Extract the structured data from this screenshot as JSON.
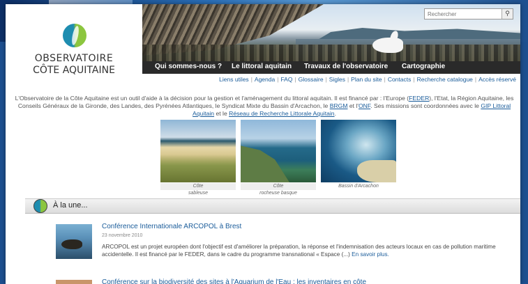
{
  "site": {
    "logo_line1": "OBSERVATOIRE",
    "logo_line2": "CÔTE AQUITAINE"
  },
  "search": {
    "placeholder": "Rechercher",
    "button_icon": "search-icon"
  },
  "main_nav": [
    {
      "label": "Qui sommes-nous ?"
    },
    {
      "label": "Le littoral aquitain"
    },
    {
      "label": "Travaux de l'observatoire"
    },
    {
      "label": "Cartographie"
    }
  ],
  "sub_nav": [
    {
      "label": "Liens utiles"
    },
    {
      "label": "Agenda"
    },
    {
      "label": "FAQ"
    },
    {
      "label": "Glossaire"
    },
    {
      "label": "Sigles"
    },
    {
      "label": "Plan du site"
    },
    {
      "label": "Contacts"
    },
    {
      "label": "Recherche catalogue"
    },
    {
      "label": "Accès réservé"
    }
  ],
  "intro": {
    "part1": "L'Observatoire de la Côte Aquitaine est un outil d'aide à la décision pour la gestion et l'aménagement du littoral aquitain. Il est financé par : l'Europe (",
    "feder": "FEDER",
    "part2": "), l'Etat, la Région Aquitaine, les Conseils Généraux de la Gironde, des Landes, des Pyrénées Atlantiques, le Syndicat Mixte du Bassin d'Arcachon, le ",
    "brgm": "BRGM",
    "part3": " et l'",
    "onf": "ONF",
    "part4": ". Ses missions sont coordonnées avec le ",
    "gip": "GIP Littoral Aquitain",
    "part5": " et le ",
    "reseau": "Réseau de Recherche Littorale Aquitain",
    "part6": "."
  },
  "photos": [
    {
      "caption_line1": "Côte",
      "caption_line2": "sableuse"
    },
    {
      "caption_line1": "Côte",
      "caption_line2": "rocheuse basque"
    },
    {
      "caption_line1": "Bassin d'Arcachon",
      "caption_line2": ""
    }
  ],
  "une": {
    "title": "À la une..."
  },
  "news": [
    {
      "title": "Conférence Internationale ARCOPOL à Brest",
      "date": "23 novembre 2010",
      "body": "ARCOPOL est un projet européen dont l'objectif est d'améliorer la préparation, la réponse et l'indemnisation des acteurs locaux en cas de pollution maritime accidentelle. Il est financé par le FEDER, dans le cadre du programme transnational « Espace (...) ",
      "more": "En savoir plus."
    },
    {
      "title": "Conférence sur la biodiversité des sites à l'Aquarium de l'Eau : les inventaires en côte"
    }
  ],
  "colors": {
    "nav_bg": "#2a2a2a",
    "link": "#1a5c9a",
    "logo_blue": "#1e8db0",
    "logo_green": "#8cc63f"
  }
}
